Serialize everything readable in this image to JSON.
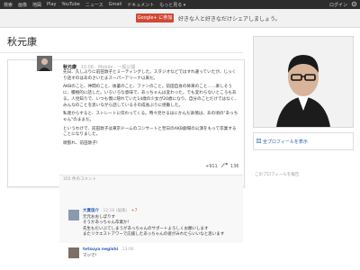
{
  "topbar": {
    "nav": [
      "検索",
      "画像",
      "地図",
      "Play",
      "YouTube",
      "ニュース",
      "Gmail",
      "ドキュメント",
      "もっと見る ▾"
    ],
    "login": "ログイン"
  },
  "banner": {
    "button_label": "Google+ に参加",
    "text": "好きな人と好きなだけシェアしましょう。"
  },
  "profile": {
    "name": "秋元康",
    "link_label": "全プロフィールを表示",
    "footer": "このプロフィールを報告"
  },
  "post": {
    "author": "秋元康",
    "meta": "10:06 - Mobile - 一般公開",
    "paragraphs": [
      "先日、久しぶりに前田敦子とミーティングした。スタジオなどではすれ違っていたが、じっくり話すのはあのさいたまスーパーアリーナ以来だ。",
      "AKBのこと、仲間のこと、後輩のこと、ファンのこと。前田自身の将来のこと……楽しそうに、積極的に話した。いろいろな意味で、あっちゃんは変わった。でも変わらないところもある。人見知りで、いつも僕に隠れていた14歳の少女が20歳になり、自分のことだけではなく、みんなのことを思いながら話しているその成長ぶりに感動した。",
      "私達からすると、ストレートに伝わってくる。時々見せるはにかんだ表情は、あの頃の\"あっちゃん\"のままだ。",
      "というわけで、前田敦子は東京ドームのコンサートと翌日のAKB劇場の公演をもって卒業することになりました。",
      "頑張れ、前田敦子！"
    ],
    "plus_count": "+911",
    "share_count": "136"
  },
  "comments": {
    "header": "355 件のコメント",
    "items": [
      {
        "author": "大貫信介",
        "time": "12:16 (編集)",
        "plus": "+7",
        "lines": [
          "元元おおしぼりす",
          "そうかあっちゃん卒業か！",
          "先生もだいぶてしまうがあっちゃんのサポートよろしくお願いします",
          "またリクエストアワーで応援したあっちゃんの姿がみれたらいいなと思います"
        ]
      },
      {
        "author": "tetsuya negishi",
        "time": "13:06",
        "plus": "",
        "lines": [
          "マジで！"
        ]
      }
    ]
  }
}
